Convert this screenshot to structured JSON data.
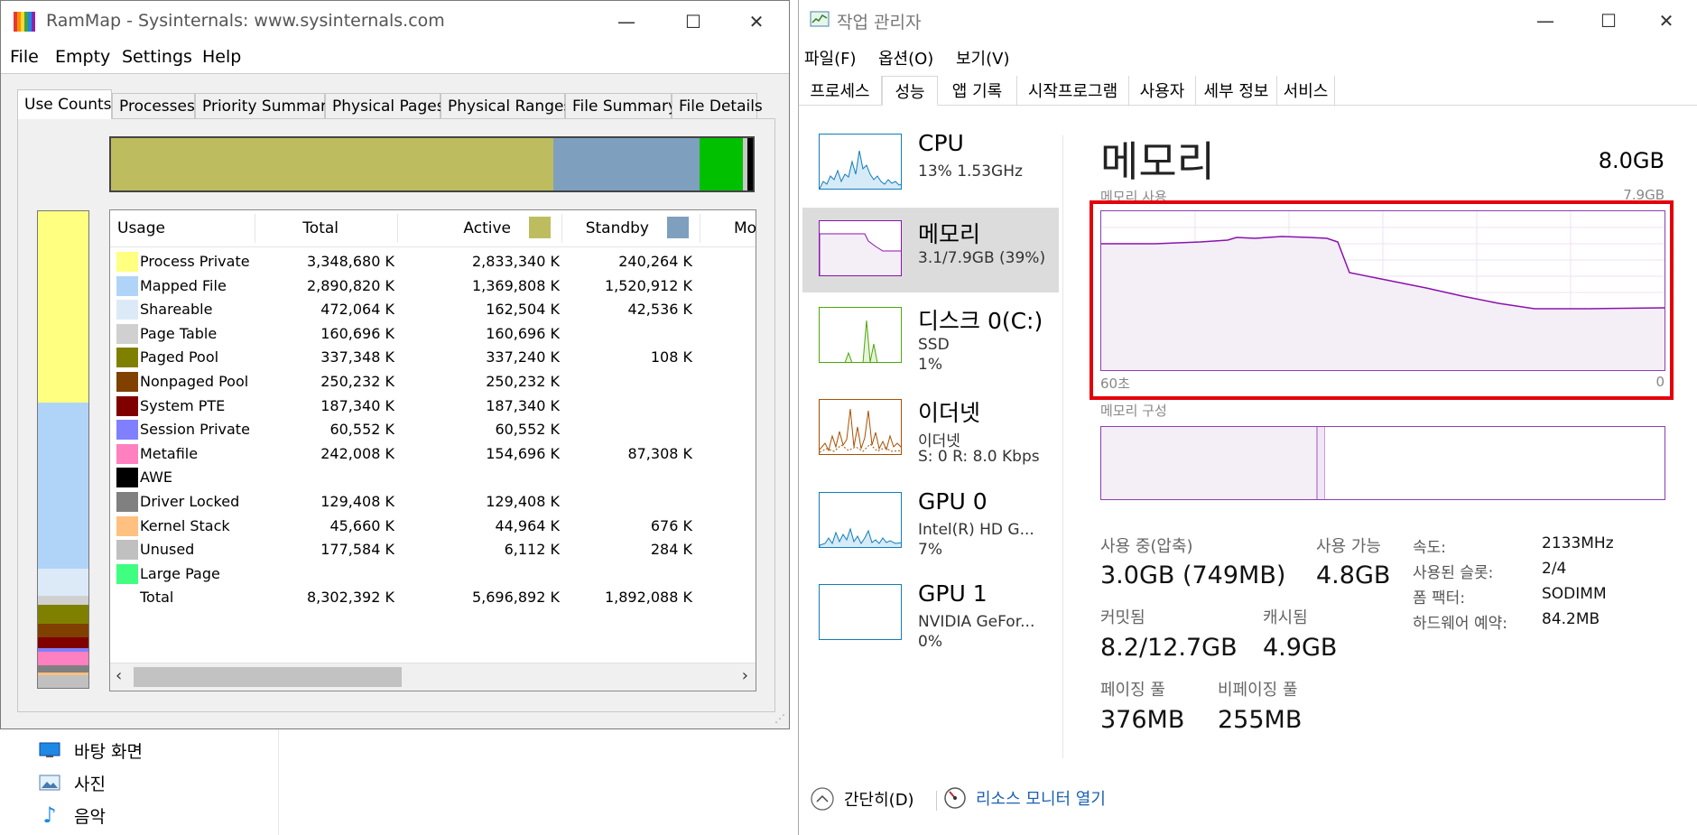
{
  "explorer": {
    "items": [
      {
        "label": "바탕 화면",
        "icon": "desktop-icon"
      },
      {
        "label": "사진",
        "icon": "pictures-icon"
      },
      {
        "label": "음악",
        "icon": "music-icon"
      }
    ]
  },
  "rammap": {
    "title": "RamMap - Sysinternals: www.sysinternals.com",
    "menu": [
      "File",
      "Empty",
      "Settings",
      "Help"
    ],
    "tabs": [
      "Use Counts",
      "Processes",
      "Priority Summary",
      "Physical Pages",
      "Physical Ranges",
      "File Summary",
      "File Details"
    ],
    "active_tab": "Use Counts",
    "columns": {
      "usage": "Usage",
      "total": "Total",
      "active": "Active",
      "standby": "Standby",
      "modified": "Mo"
    },
    "rows": [
      {
        "label": "Process Private",
        "color": "#ffff80",
        "total": "3,348,680 K",
        "active": "2,833,340 K",
        "standby": "240,264 K"
      },
      {
        "label": "Mapped File",
        "color": "#b0d4f8",
        "total": "2,890,820 K",
        "active": "1,369,808 K",
        "standby": "1,520,912 K"
      },
      {
        "label": "Shareable",
        "color": "#dceaf8",
        "total": "472,064 K",
        "active": "162,504 K",
        "standby": "42,536 K"
      },
      {
        "label": "Page Table",
        "color": "#d0d0d0",
        "total": "160,696 K",
        "active": "160,696 K",
        "standby": ""
      },
      {
        "label": "Paged Pool",
        "color": "#808000",
        "total": "337,348 K",
        "active": "337,240 K",
        "standby": "108 K"
      },
      {
        "label": "Nonpaged Pool",
        "color": "#804000",
        "total": "250,232 K",
        "active": "250,232 K",
        "standby": ""
      },
      {
        "label": "System PTE",
        "color": "#800000",
        "total": "187,340 K",
        "active": "187,340 K",
        "standby": ""
      },
      {
        "label": "Session Private",
        "color": "#8080ff",
        "total": "60,552 K",
        "active": "60,552 K",
        "standby": ""
      },
      {
        "label": "Metafile",
        "color": "#ff80c0",
        "total": "242,008 K",
        "active": "154,696 K",
        "standby": "87,308 K"
      },
      {
        "label": "AWE",
        "color": "#000000",
        "total": "",
        "active": "",
        "standby": ""
      },
      {
        "label": "Driver Locked",
        "color": "#808080",
        "total": "129,408 K",
        "active": "129,408 K",
        "standby": ""
      },
      {
        "label": "Kernel Stack",
        "color": "#ffc080",
        "total": "45,660 K",
        "active": "44,964 K",
        "standby": "676 K"
      },
      {
        "label": "Unused",
        "color": "#c0c0c0",
        "total": "177,584 K",
        "active": "6,112 K",
        "standby": "284 K"
      },
      {
        "label": "Large Page",
        "color": "#40ff80",
        "total": "",
        "active": "",
        "standby": ""
      },
      {
        "label": "Total",
        "color": "",
        "total": "8,302,392 K",
        "active": "5,696,892 K",
        "standby": "1,892,088 K"
      }
    ],
    "colors": {
      "active": "#bdbd60",
      "standby": "#7f9fbf",
      "modified": "#00c000"
    }
  },
  "taskmgr": {
    "title": "작업 관리자",
    "menu": [
      "파일(F)",
      "옵션(O)",
      "보기(V)"
    ],
    "tabs": [
      "프로세스",
      "성능",
      "앱 기록",
      "시작프로그램",
      "사용자",
      "세부 정보",
      "서비스"
    ],
    "active_tab": "성능",
    "sidebar": [
      {
        "name": "CPU",
        "sub1": "13% 1.53GHz",
        "sub2": "",
        "color": "#117dbb"
      },
      {
        "name": "메모리",
        "sub1": "3.1/7.9GB (39%)",
        "sub2": "",
        "color": "#8b12ae"
      },
      {
        "name": "디스크 0(C:)",
        "sub1": "SSD",
        "sub2": "1%",
        "color": "#4da60c"
      },
      {
        "name": "이더넷",
        "sub1": "이더넷",
        "sub2": "S: 0 R: 8.0 Kbps",
        "color": "#a74f01"
      },
      {
        "name": "GPU 0",
        "sub1": "Intel(R) HD G...",
        "sub2": "7%",
        "color": "#117dbb"
      },
      {
        "name": "GPU 1",
        "sub1": "NVIDIA GeFor...",
        "sub2": "0%",
        "color": "#117dbb"
      }
    ],
    "memory": {
      "title": "메모리",
      "total": "8.0GB",
      "usage_label": "메모리 사용",
      "usage_max": "7.9GB",
      "axis_left": "60초",
      "axis_right": "0",
      "composition_label": "메모리 구성",
      "stats": {
        "in_use_label": "사용 중(압축)",
        "in_use": "3.0GB (749MB)",
        "available_label": "사용 가능",
        "available": "4.8GB",
        "committed_label": "커밋됨",
        "committed": "8.2/12.7GB",
        "cached_label": "캐시됨",
        "cached": "4.9GB",
        "paged_label": "페이징 풀",
        "paged": "376MB",
        "nonpaged_label": "비페이징 풀",
        "nonpaged": "255MB"
      },
      "specs": [
        {
          "label": "속도:",
          "value": "2133MHz"
        },
        {
          "label": "사용된 슬롯:",
          "value": "2/4"
        },
        {
          "label": "폼 팩터:",
          "value": "SODIMM"
        },
        {
          "label": "하드웨어 예약:",
          "value": "84.2MB"
        }
      ]
    },
    "footer": {
      "less_details": "간단히(D)",
      "open_monitor": "리소스 모니터 열기"
    }
  }
}
